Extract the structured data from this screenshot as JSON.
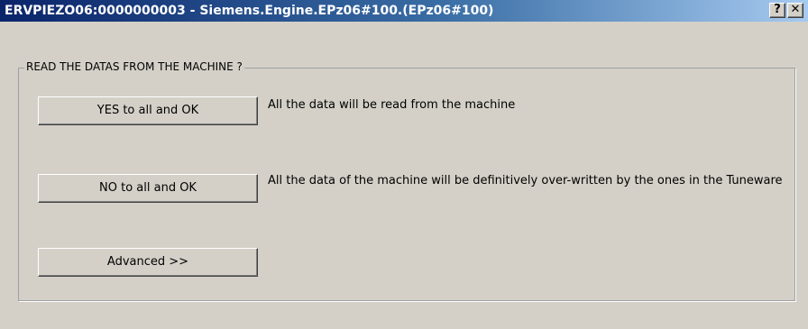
{
  "window": {
    "title": "ERVPIEZO06:0000000003 - Siemens.Engine.EPz06#100.(EPz06#100)",
    "help_label": "?",
    "close_label": "✕"
  },
  "group": {
    "label": "READ THE DATAS FROM THE MACHINE ?"
  },
  "options": {
    "yes": {
      "button_label": "YES to all and OK",
      "description": "All the data will be read from the machine"
    },
    "no": {
      "button_label": "NO to all and OK",
      "description": "All the data of the machine will be definitively over-written by the ones in the Tuneware"
    },
    "advanced": {
      "button_label": "Advanced >>"
    }
  },
  "colors": {
    "face": "#d4d0c8",
    "titlebar_start": "#0a246a",
    "titlebar_end": "#a6caf0"
  }
}
